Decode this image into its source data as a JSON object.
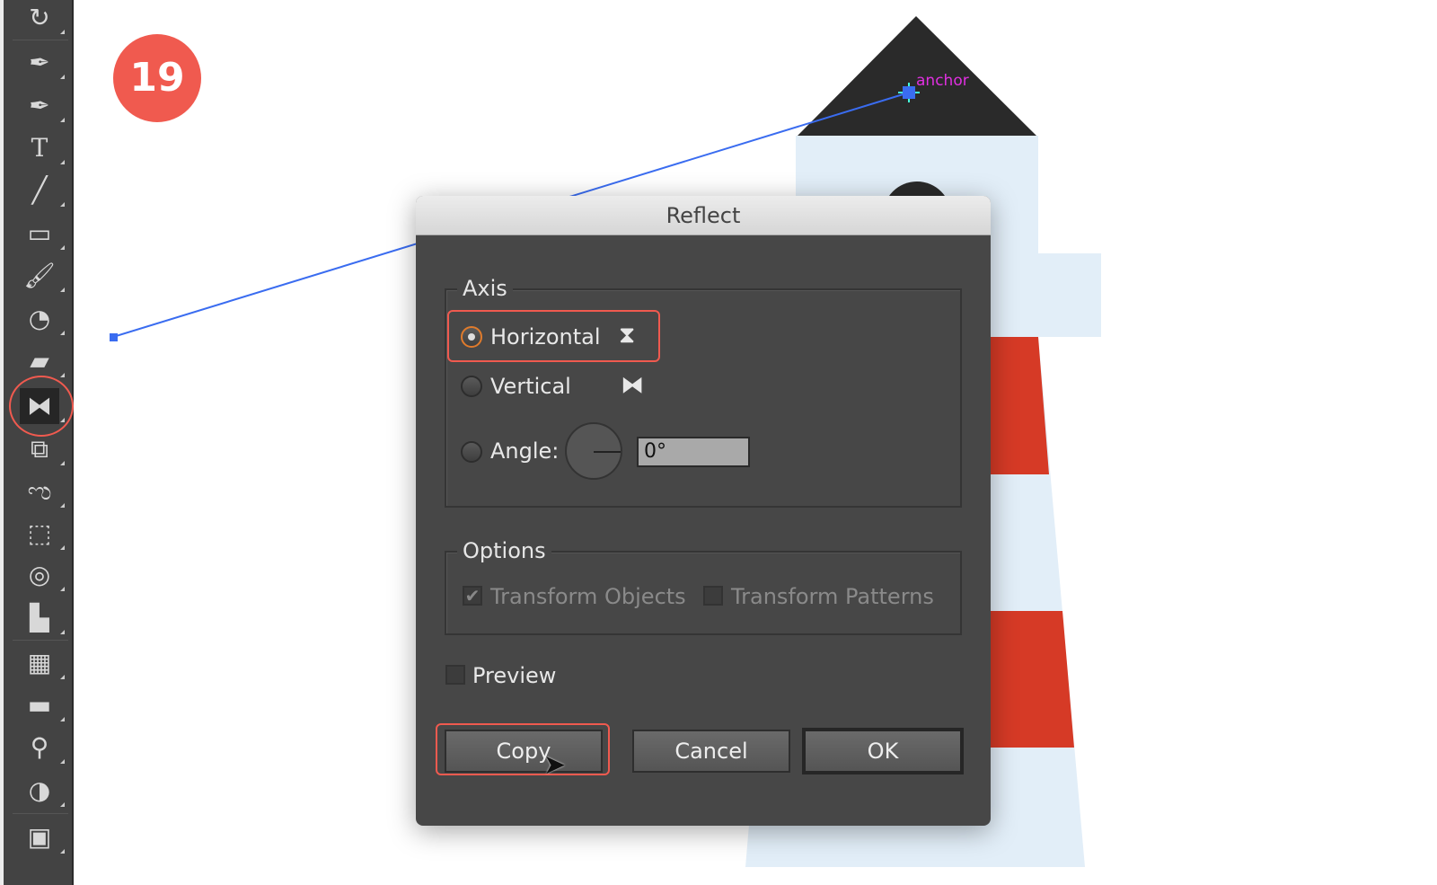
{
  "step_badge": "19",
  "canvas": {
    "anchor_label": "anchor",
    "colors": {
      "guide": "#3a6cf0",
      "anchor_label": "#e030e0",
      "roof": "#2a2a2a",
      "body": "#e2eef8",
      "stripe": "#d63a26"
    }
  },
  "toolbar": {
    "tools": [
      "rotate-tool",
      "pen-tool",
      "curvature-tool",
      "type-tool",
      "line-tool",
      "rectangle-tool",
      "paintbrush-tool",
      "shaper-tool",
      "eraser-tool",
      "reflect-tool",
      "scale-tool",
      "warp-tool",
      "free-transform-tool",
      "shape-builder-tool",
      "graph-tool",
      "mesh-tool",
      "gradient-tool",
      "eyedropper-tool",
      "blend-tool",
      "symbol-sprayer-tool"
    ],
    "active": "reflect-tool"
  },
  "dialog": {
    "title": "Reflect",
    "axis": {
      "legend": "Axis",
      "horizontal": "Horizontal",
      "vertical": "Vertical",
      "angle_label": "Angle:",
      "angle_value": "0°",
      "selected": "horizontal"
    },
    "options": {
      "legend": "Options",
      "transform_objects": "Transform Objects",
      "transform_objects_checked": true,
      "transform_patterns": "Transform Patterns",
      "transform_patterns_checked": false
    },
    "preview": {
      "label": "Preview",
      "checked": false
    },
    "buttons": {
      "copy": "Copy",
      "cancel": "Cancel",
      "ok": "OK"
    }
  },
  "accent": "#f05a4f"
}
